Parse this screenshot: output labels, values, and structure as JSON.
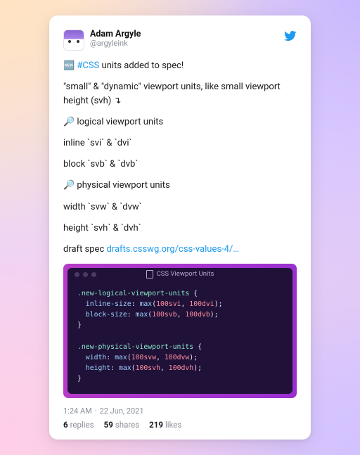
{
  "author": {
    "name": "Adam Argyle",
    "handle": "@argyleink"
  },
  "tweet": {
    "line_intro_prefix": "🆕 ",
    "hashtag": "#CSS",
    "line_intro_suffix": " units added to spec!",
    "line_desc": "\"small\" & \"dynamic\" viewport units, like small viewport height (svh) ↴",
    "sec1_head": "🔎 logical viewport units",
    "sec1_l1": "inline `svi` & `dvi`",
    "sec1_l2": "block `svb` & `dvb`",
    "sec2_head": "🔎 physical viewport units",
    "sec2_l1": "width `svw` & `dvw`",
    "sec2_l2": "height `svh` & `dvh`",
    "draft_label": "draft spec ",
    "draft_link": "drafts.csswg.org/css-values-4/#…"
  },
  "code": {
    "title": "CSS Viewport Units",
    "sel1": ".new-logical-viewport-units",
    "p1a": "inline-size",
    "p1b": "block-size",
    "v1a_a": "100svi",
    "v1a_b": "100dvi",
    "v1b_a": "100svb",
    "v1b_b": "100dvb",
    "sel2": ".new-physical-viewport-units",
    "p2a": "width",
    "p2b": "height",
    "v2a_a": "100svw",
    "v2a_b": "100dvw",
    "v2b_a": "100svh",
    "v2b_b": "100dvh",
    "func": "max"
  },
  "meta": {
    "time": "1:24 AM",
    "date": "22 Jun, 2021"
  },
  "stats": {
    "replies_n": "6",
    "replies_l": "replies",
    "shares_n": "59",
    "shares_l": "shares",
    "likes_n": "219",
    "likes_l": "likes"
  }
}
